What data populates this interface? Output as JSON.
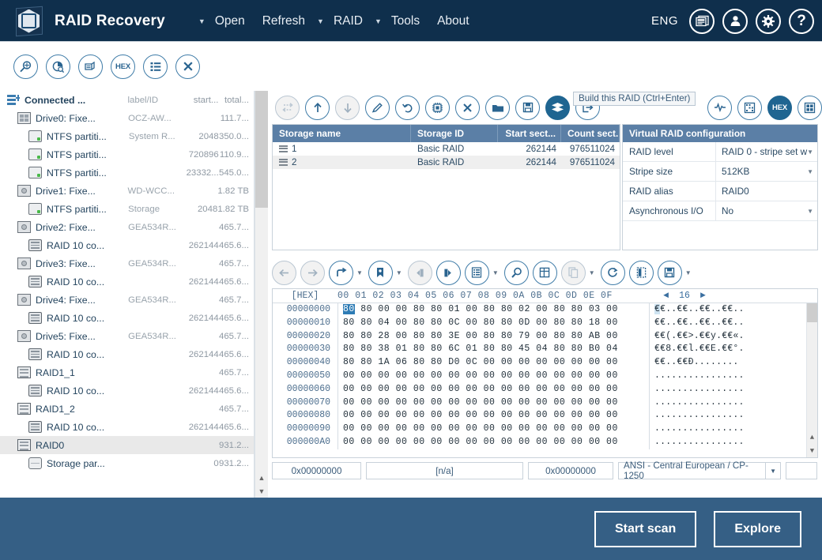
{
  "app": {
    "title": "RAID Recovery",
    "language": "ENG",
    "logo_icon": "raid-hex-logo-icon"
  },
  "menu": [
    {
      "label": "Open",
      "has_caret": true
    },
    {
      "label": "Refresh",
      "has_caret": false
    },
    {
      "label": "RAID",
      "has_caret": true
    },
    {
      "label": "Tools",
      "has_caret": false
    },
    {
      "label": "About",
      "has_caret": false
    }
  ],
  "titlebar_icons": [
    "notes-icon",
    "user-icon",
    "gear-icon",
    "help-icon"
  ],
  "left_toolbar": [
    {
      "name": "find-icon",
      "label": ""
    },
    {
      "name": "disk-analysis-icon",
      "label": ""
    },
    {
      "name": "open-image-icon",
      "label": ""
    },
    {
      "name": "hex-view-icon",
      "label": "HEX"
    },
    {
      "name": "properties-list-icon",
      "label": ""
    },
    {
      "name": "close-icon",
      "label": ""
    }
  ],
  "sidebar": {
    "columns": {
      "name": "Connected ...",
      "label": "label/ID",
      "start": "start...",
      "total": "total..."
    },
    "rows": [
      {
        "icon": "connected-drives-icon",
        "indent": 0,
        "name": "Connected ...",
        "label": "label/ID",
        "start": "start...",
        "total": "total...",
        "header": true,
        "selected": false
      },
      {
        "icon": "ssd-icon",
        "indent": 1,
        "name": "Drive0: Fixe...",
        "label": "OCZ-AW...",
        "start": "",
        "total": "111.7...",
        "header": false,
        "selected": false
      },
      {
        "icon": "partition-icon",
        "indent": 2,
        "name": "NTFS partiti...",
        "label": "System R...",
        "start": "2048",
        "total": "350.0...",
        "header": false,
        "selected": false
      },
      {
        "icon": "partition-icon",
        "indent": 2,
        "name": "NTFS partiti...",
        "label": "",
        "start": "720896",
        "total": "110.9...",
        "header": false,
        "selected": false
      },
      {
        "icon": "partition-icon",
        "indent": 2,
        "name": "NTFS partiti...",
        "label": "",
        "start": "23332...",
        "total": "545.0...",
        "header": false,
        "selected": false
      },
      {
        "icon": "hdd-icon",
        "indent": 1,
        "name": "Drive1: Fixe...",
        "label": "WD-WCC...",
        "start": "",
        "total": "1.82 TB",
        "header": false,
        "selected": false
      },
      {
        "icon": "partition-icon",
        "indent": 2,
        "name": "NTFS partiti...",
        "label": "Storage",
        "start": "2048",
        "total": "1.82 TB",
        "header": false,
        "selected": false
      },
      {
        "icon": "hdd-icon",
        "indent": 1,
        "name": "Drive2: Fixe...",
        "label": "GEA534R...",
        "start": "",
        "total": "465.7...",
        "header": false,
        "selected": false
      },
      {
        "icon": "raid-component-icon",
        "indent": 2,
        "name": "RAID 10 co...",
        "label": "",
        "start": "262144",
        "total": "465.6...",
        "header": false,
        "selected": false
      },
      {
        "icon": "hdd-icon",
        "indent": 1,
        "name": "Drive3: Fixe...",
        "label": "GEA534R...",
        "start": "",
        "total": "465.7...",
        "header": false,
        "selected": false
      },
      {
        "icon": "raid-component-icon",
        "indent": 2,
        "name": "RAID 10 co...",
        "label": "",
        "start": "262144",
        "total": "465.6...",
        "header": false,
        "selected": false
      },
      {
        "icon": "hdd-icon",
        "indent": 1,
        "name": "Drive4: Fixe...",
        "label": "GEA534R...",
        "start": "",
        "total": "465.7...",
        "header": false,
        "selected": false
      },
      {
        "icon": "raid-component-icon",
        "indent": 2,
        "name": "RAID 10 co...",
        "label": "",
        "start": "262144",
        "total": "465.6...",
        "header": false,
        "selected": false
      },
      {
        "icon": "hdd-icon",
        "indent": 1,
        "name": "Drive5: Fixe...",
        "label": "GEA534R...",
        "start": "",
        "total": "465.7...",
        "header": false,
        "selected": false
      },
      {
        "icon": "raid-component-icon",
        "indent": 2,
        "name": "RAID 10 co...",
        "label": "",
        "start": "262144",
        "total": "465.6...",
        "header": false,
        "selected": false
      },
      {
        "icon": "raid-volume-icon",
        "indent": 1,
        "name": "RAID1_1",
        "label": "",
        "start": "",
        "total": "465.7...",
        "header": false,
        "selected": false
      },
      {
        "icon": "raid-component-icon",
        "indent": 2,
        "name": "RAID 10 co...",
        "label": "",
        "start": "262144",
        "total": "465.6...",
        "header": false,
        "selected": false
      },
      {
        "icon": "raid-volume-icon",
        "indent": 1,
        "name": "RAID1_2",
        "label": "",
        "start": "",
        "total": "465.7...",
        "header": false,
        "selected": false
      },
      {
        "icon": "raid-component-icon",
        "indent": 2,
        "name": "RAID 10 co...",
        "label": "",
        "start": "262144",
        "total": "465.6...",
        "header": false,
        "selected": false
      },
      {
        "icon": "raid-volume-icon",
        "indent": 1,
        "name": "RAID0",
        "label": "",
        "start": "",
        "total": "931.2...",
        "header": false,
        "selected": true
      },
      {
        "icon": "storage-partition-icon",
        "indent": 2,
        "name": "Storage par...",
        "label": "",
        "start": "0",
        "total": "931.2...",
        "header": false,
        "selected": false
      }
    ]
  },
  "right_toolbar": {
    "left_icons": [
      "reorder-disabled-icon",
      "move-up-icon",
      "move-down-icon",
      "edit-icon",
      "undo-icon",
      "chip-icon",
      "remove-icon",
      "open-folder-icon",
      "save-icon",
      "build-raid-icon",
      "export-icon"
    ],
    "right_icons": [
      "health-icon",
      "sectors-map-icon",
      "hex-icon",
      "blocks-icon"
    ],
    "hex_label": "HEX"
  },
  "tooltip": {
    "text": "Build this RAID (Ctrl+Enter)"
  },
  "storage_table": {
    "headers": [
      "Storage name",
      "Storage ID",
      "Start sect...",
      "Count sect..."
    ],
    "rows": [
      {
        "icon": "storage-row-icon",
        "name": "1",
        "id": "Basic RAID",
        "start": "262144",
        "count": "976511024"
      },
      {
        "icon": "storage-row-icon",
        "name": "2",
        "id": "Basic RAID",
        "start": "262144",
        "count": "976511024"
      }
    ]
  },
  "raid_config": {
    "title": "Virtual RAID configuration",
    "rows": [
      {
        "key": "RAID level",
        "value": "RAID 0 - stripe set w",
        "dropdown": true
      },
      {
        "key": "Stripe size",
        "value": "512KB",
        "dropdown": true
      },
      {
        "key": "RAID alias",
        "value": "RAID0",
        "dropdown": false
      },
      {
        "key": "Asynchronous I/O",
        "value": "No",
        "dropdown": true
      }
    ]
  },
  "hex_toolbar": [
    {
      "name": "back-icon",
      "caret": false,
      "dim": true
    },
    {
      "name": "forward-icon",
      "caret": false,
      "dim": true
    },
    {
      "name": "goto-icon",
      "caret": true,
      "dim": false
    },
    {
      "name": "bookmark-icon",
      "caret": true,
      "dim": false
    },
    {
      "name": "prev-bookmark-icon",
      "caret": false,
      "dim": true
    },
    {
      "name": "next-bookmark-icon",
      "caret": false,
      "dim": false
    },
    {
      "name": "template-list-icon",
      "caret": true,
      "dim": false
    },
    {
      "name": "search-icon",
      "caret": false,
      "dim": false
    },
    {
      "name": "table-view-icon",
      "caret": false,
      "dim": false
    },
    {
      "name": "copy-icon",
      "caret": true,
      "dim": true
    },
    {
      "name": "refresh-icon",
      "caret": false,
      "dim": false
    },
    {
      "name": "column-view-icon",
      "caret": false,
      "dim": false
    },
    {
      "name": "save-file-icon",
      "caret": true,
      "dim": false
    }
  ],
  "hex_editor": {
    "offset_label": "[HEX]",
    "column_labels": "00 01 02 03 04 05 06 07 08 09 0A 0B 0C 0D 0E 0F",
    "bytes_per_row": "16",
    "pager_prev": "◄",
    "pager_next": "►",
    "selected_byte": "80",
    "lines": [
      {
        "offset": "00000000",
        "bytes": "80 80 00 00 80 80 01 00 80 80 02 00 80 80 03 00",
        "ascii": "€€..€€..€€..€€.."
      },
      {
        "offset": "00000010",
        "bytes": "80 80 04 00 80 80 0C 00 80 80 0D 00 80 80 18 00",
        "ascii": "€€..€€..€€..€€.."
      },
      {
        "offset": "00000020",
        "bytes": "80 80 28 00 80 80 3E 00 80 80 79 00 80 80 AB 00",
        "ascii": "€€(.€€>.€€y.€€«."
      },
      {
        "offset": "00000030",
        "bytes": "80 80 38 01 80 80 6C 01 80 80 45 04 80 80 B0 04",
        "ascii": "€€8.€€l.€€E.€€°."
      },
      {
        "offset": "00000040",
        "bytes": "80 80 1A 06 80 80 D0 0C 00 00 00 00 00 00 00 00",
        "ascii": "€€..€€Ð........"
      },
      {
        "offset": "00000050",
        "bytes": "00 00 00 00 00 00 00 00 00 00 00 00 00 00 00 00",
        "ascii": "................"
      },
      {
        "offset": "00000060",
        "bytes": "00 00 00 00 00 00 00 00 00 00 00 00 00 00 00 00",
        "ascii": "................"
      },
      {
        "offset": "00000070",
        "bytes": "00 00 00 00 00 00 00 00 00 00 00 00 00 00 00 00",
        "ascii": "................"
      },
      {
        "offset": "00000080",
        "bytes": "00 00 00 00 00 00 00 00 00 00 00 00 00 00 00 00",
        "ascii": "................"
      },
      {
        "offset": "00000090",
        "bytes": "00 00 00 00 00 00 00 00 00 00 00 00 00 00 00 00",
        "ascii": "................"
      },
      {
        "offset": "000000A0",
        "bytes": "00 00 00 00 00 00 00 00 00 00 00 00 00 00 00 00",
        "ascii": "................"
      }
    ]
  },
  "status_fields": {
    "offset": "0x00000000",
    "value": "[n/a]",
    "selection": "0x00000000",
    "encoding": "ANSI - Central European / CP-1250"
  },
  "footer": {
    "start_scan": "Start scan",
    "explore": "Explore"
  },
  "colors": {
    "titlebar": "#0f2f4c",
    "footer": "#355f85",
    "table_header": "#5b7fa6",
    "accent": "#2e7cb5",
    "selection": "#e9e9e9"
  }
}
